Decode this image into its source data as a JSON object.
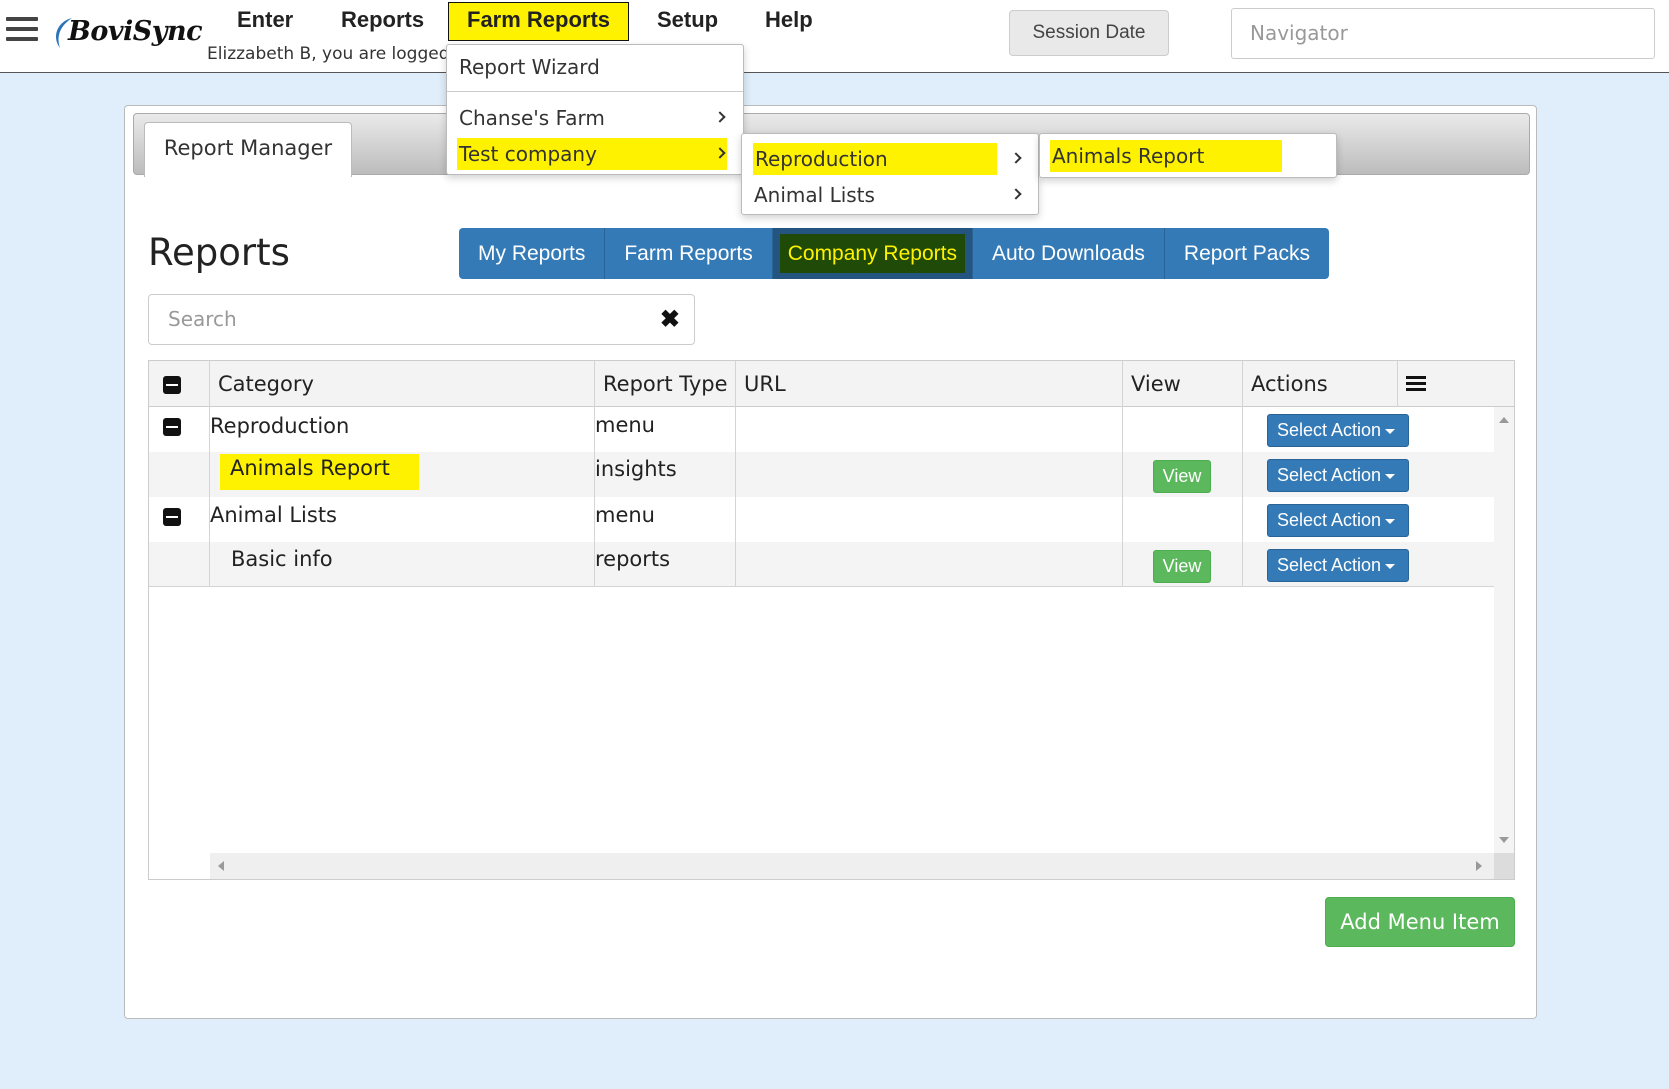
{
  "app": {
    "brand": "BoviSync",
    "user_notice": "Elizzabeth B, you are logged"
  },
  "nav": {
    "items": [
      "Enter",
      "Reports",
      "Farm Reports",
      "Setup",
      "Help"
    ],
    "active": "Farm Reports"
  },
  "header": {
    "session_date_label": "Session Date",
    "navigator_placeholder": "Navigator"
  },
  "farm_reports_menu": {
    "report_wizard": "Report Wizard",
    "chanses_farm": "Chanse's Farm",
    "test_company": "Test company"
  },
  "test_company_submenu": {
    "reproduction": "Reproduction",
    "animal_lists": "Animal Lists"
  },
  "reproduction_submenu": {
    "animals_report": "Animals Report"
  },
  "panel": {
    "tab_label": "Report Manager",
    "title": "Reports"
  },
  "report_tabs": {
    "items": [
      "My Reports",
      "Farm Reports",
      "Company Reports",
      "Auto Downloads",
      "Report Packs"
    ],
    "active": "Company Reports"
  },
  "search": {
    "placeholder": "Search"
  },
  "grid": {
    "columns": [
      "Category",
      "Report Type",
      "URL",
      "View",
      "Actions"
    ],
    "rows": [
      {
        "category": "Reproduction",
        "type": "menu",
        "url": "",
        "view": "",
        "action": "Select Action",
        "group": true
      },
      {
        "category": "Animals Report",
        "type": "insights",
        "url": "",
        "view": "View",
        "action": "Select Action",
        "group": false
      },
      {
        "category": "Animal Lists",
        "type": "menu",
        "url": "",
        "view": "",
        "action": "Select Action",
        "group": true
      },
      {
        "category": "Basic info",
        "type": "reports",
        "url": "",
        "view": "View",
        "action": "Select Action",
        "group": false
      }
    ]
  },
  "footer": {
    "add_menu_item": "Add Menu Item"
  },
  "colors": {
    "primary": "#337ab7",
    "success": "#5cb85c",
    "highlight": "#fff200",
    "page_bg": "#dfeefa"
  }
}
